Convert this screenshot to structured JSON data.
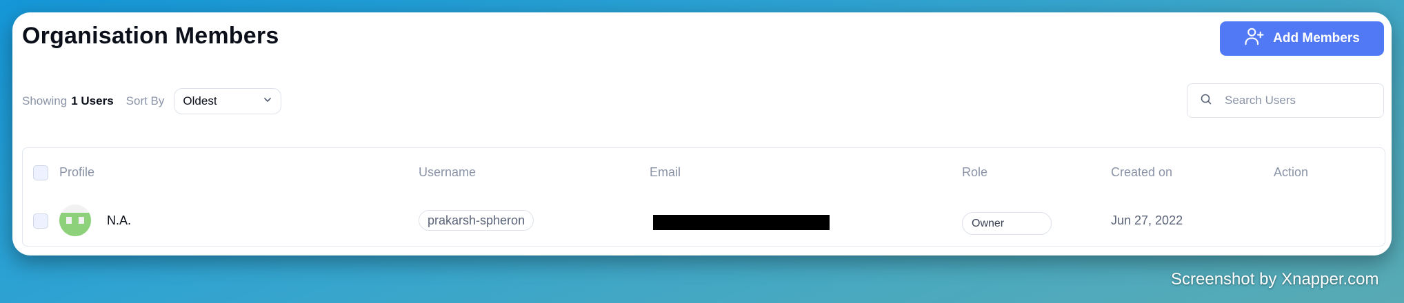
{
  "page": {
    "title": "Organisation Members"
  },
  "actions": {
    "add_members_label": "Add Members"
  },
  "toolbar": {
    "showing_label": "Showing",
    "showing_count": "1 Users",
    "sort_by_label": "Sort By",
    "sort_value": "Oldest",
    "search_placeholder": "Search Users"
  },
  "table": {
    "columns": [
      "Profile",
      "Username",
      "Email",
      "Role",
      "Created on",
      "Action"
    ],
    "rows": [
      {
        "name": "N.A.",
        "username": "prakarsh-spheron",
        "email": "",
        "role": "Owner",
        "created_on": "Jun 27, 2022"
      }
    ]
  },
  "watermark": "Screenshot by Xnapper.com",
  "colors": {
    "accent": "#5178f5",
    "avatar_green": "#8dd17a"
  }
}
